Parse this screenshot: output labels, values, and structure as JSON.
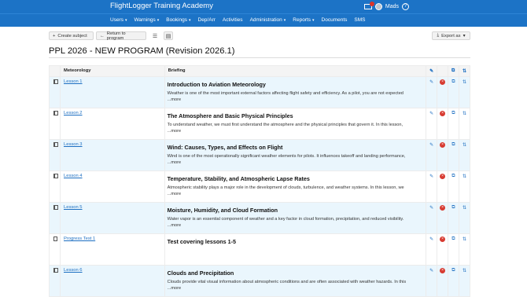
{
  "app": {
    "title": "FlightLogger Training Academy"
  },
  "user": {
    "name": "Mads"
  },
  "nav": [
    {
      "label": "Users",
      "caret": true
    },
    {
      "label": "Warnings",
      "caret": true
    },
    {
      "label": "Bookings",
      "caret": true
    },
    {
      "label": "Dep/Arr",
      "caret": false
    },
    {
      "label": "Activities",
      "caret": false
    },
    {
      "label": "Administration",
      "caret": true
    },
    {
      "label": "Reports",
      "caret": true
    },
    {
      "label": "Documents",
      "caret": false
    },
    {
      "label": "SMS",
      "caret": false
    }
  ],
  "toolbar": {
    "create_subject": "Create subject",
    "return_to_program": "Return to program",
    "export_as": "Export as"
  },
  "page": {
    "title": "PPL 2026 - NEW PROGRAM (Revision 2026.1)"
  },
  "table": {
    "headers": {
      "subject": "Meteorology",
      "briefing": "Briefing"
    },
    "rows": [
      {
        "type": "book",
        "name": "Lesson 1",
        "briefing_title": "Introduction to Aviation Meteorology",
        "briefing_text": "Weather is one of the most important external factors affecting flight safety and efficiency. As a pilot, you are not expected",
        "more": "...more"
      },
      {
        "type": "book",
        "name": "Lesson 2",
        "briefing_title": "The Atmosphere and Basic Physical Principles",
        "briefing_text": "To understand weather, we must first understand the atmosphere and the physical principles that govern it. In this lesson,",
        "more": "...more"
      },
      {
        "type": "book",
        "name": "Lesson 3",
        "briefing_title": "Wind: Causes, Types, and Effects on Flight",
        "briefing_text": "Wind is one of the most operationally significant weather elements for pilots. It influences takeoff and landing performance,",
        "more": "...more"
      },
      {
        "type": "book",
        "name": "Lesson 4",
        "briefing_title": "Temperature, Stability, and Atmospheric Lapse Rates",
        "briefing_text": "Atmospheric stability plays a major role in the development of clouds, turbulence, and weather systems. In this lesson, we",
        "more": "...more"
      },
      {
        "type": "book",
        "name": "Lesson 5",
        "briefing_title": "Moisture, Humidity, and Cloud Formation",
        "briefing_text": "Water vapor is an essential component of weather and a key factor in cloud formation, precipitation, and reduced visibility.",
        "more": "...more"
      },
      {
        "type": "doc",
        "name": "Progress Test 1",
        "briefing_title": "Test covering lessons 1-5",
        "briefing_text": "",
        "more": ""
      },
      {
        "type": "book",
        "name": "Lesson 6",
        "briefing_title": "Clouds and Precipitation",
        "briefing_text": "Clouds provide vital visual information about atmospheric conditions and are often associated with weather hazards. In this",
        "more": "...more"
      }
    ]
  }
}
